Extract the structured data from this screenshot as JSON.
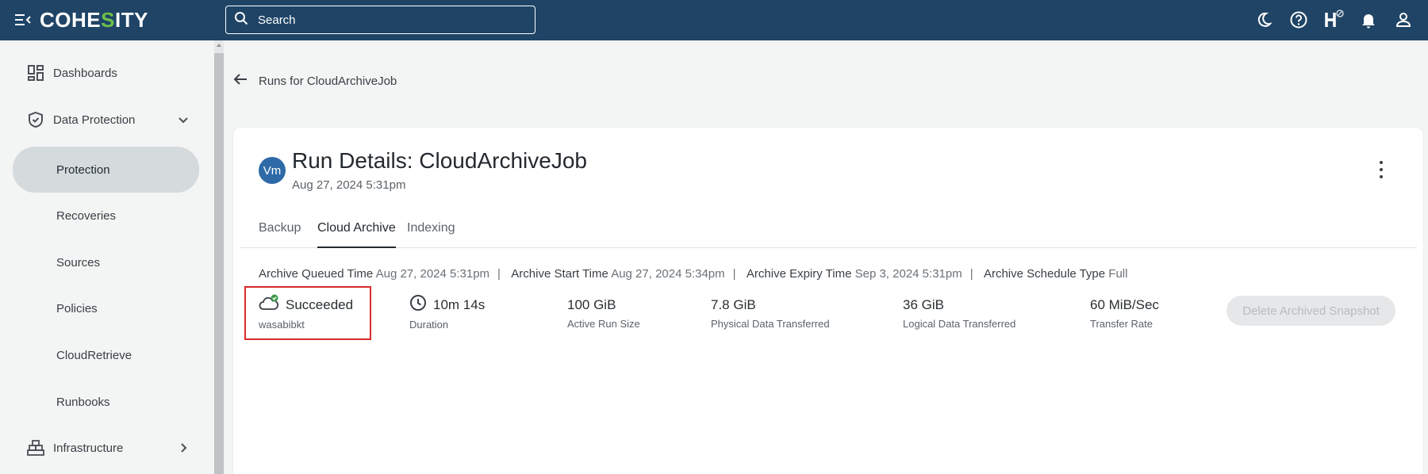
{
  "header": {
    "logo_prefix": "COHE",
    "logo_s": "S",
    "logo_suffix": "ITY",
    "search_placeholder": "Search",
    "icons": [
      "moon-icon",
      "help-icon",
      "helios-icon",
      "bell-icon",
      "user-icon"
    ]
  },
  "sidebar": {
    "items": [
      {
        "label": "Dashboards",
        "icon": "dashboard-icon"
      },
      {
        "label": "Data Protection",
        "icon": "shield-icon"
      },
      {
        "label": "Protection"
      },
      {
        "label": "Recoveries"
      },
      {
        "label": "Sources"
      },
      {
        "label": "Policies"
      },
      {
        "label": "CloudRetrieve"
      },
      {
        "label": "Runbooks"
      },
      {
        "label": "Infrastructure",
        "icon": "infrastructure-icon"
      }
    ]
  },
  "main": {
    "back_label": "Runs for CloudArchiveJob",
    "avatar": "Vm",
    "title": "Run Details: CloudArchiveJob",
    "subtitle": "Aug 27, 2024 5:31pm",
    "tabs": [
      "Backup",
      "Cloud Archive",
      "Indexing"
    ],
    "active_tab": "Cloud Archive",
    "meta": {
      "queued_label": "Archive Queued Time",
      "queued_value": "Aug 27, 2024 5:31pm",
      "start_label": "Archive Start Time",
      "start_value": "Aug 27, 2024 5:34pm",
      "expiry_label": "Archive Expiry Time",
      "expiry_value": "Sep 3, 2024 5:31pm",
      "schedule_label": "Archive Schedule Type",
      "schedule_value": "Full",
      "separator": "|"
    },
    "stats": [
      {
        "value": "Succeeded",
        "caption": "wasabibkt"
      },
      {
        "value": "10m 14s",
        "caption": "Duration"
      },
      {
        "value": "100 GiB",
        "caption": "Active Run Size"
      },
      {
        "value": "7.8 GiB",
        "caption": "Physical Data Transferred"
      },
      {
        "value": "36 GiB",
        "caption": "Logical Data Transferred"
      },
      {
        "value": "60 MiB/Sec",
        "caption": "Transfer Rate"
      }
    ],
    "delete_button": "Delete Archived Snapshot"
  },
  "colors": {
    "topbar": "#1f4466",
    "accent_green": "#6cc04a",
    "avatar": "#2e6aa7",
    "highlight_red": "#d92a2a"
  }
}
